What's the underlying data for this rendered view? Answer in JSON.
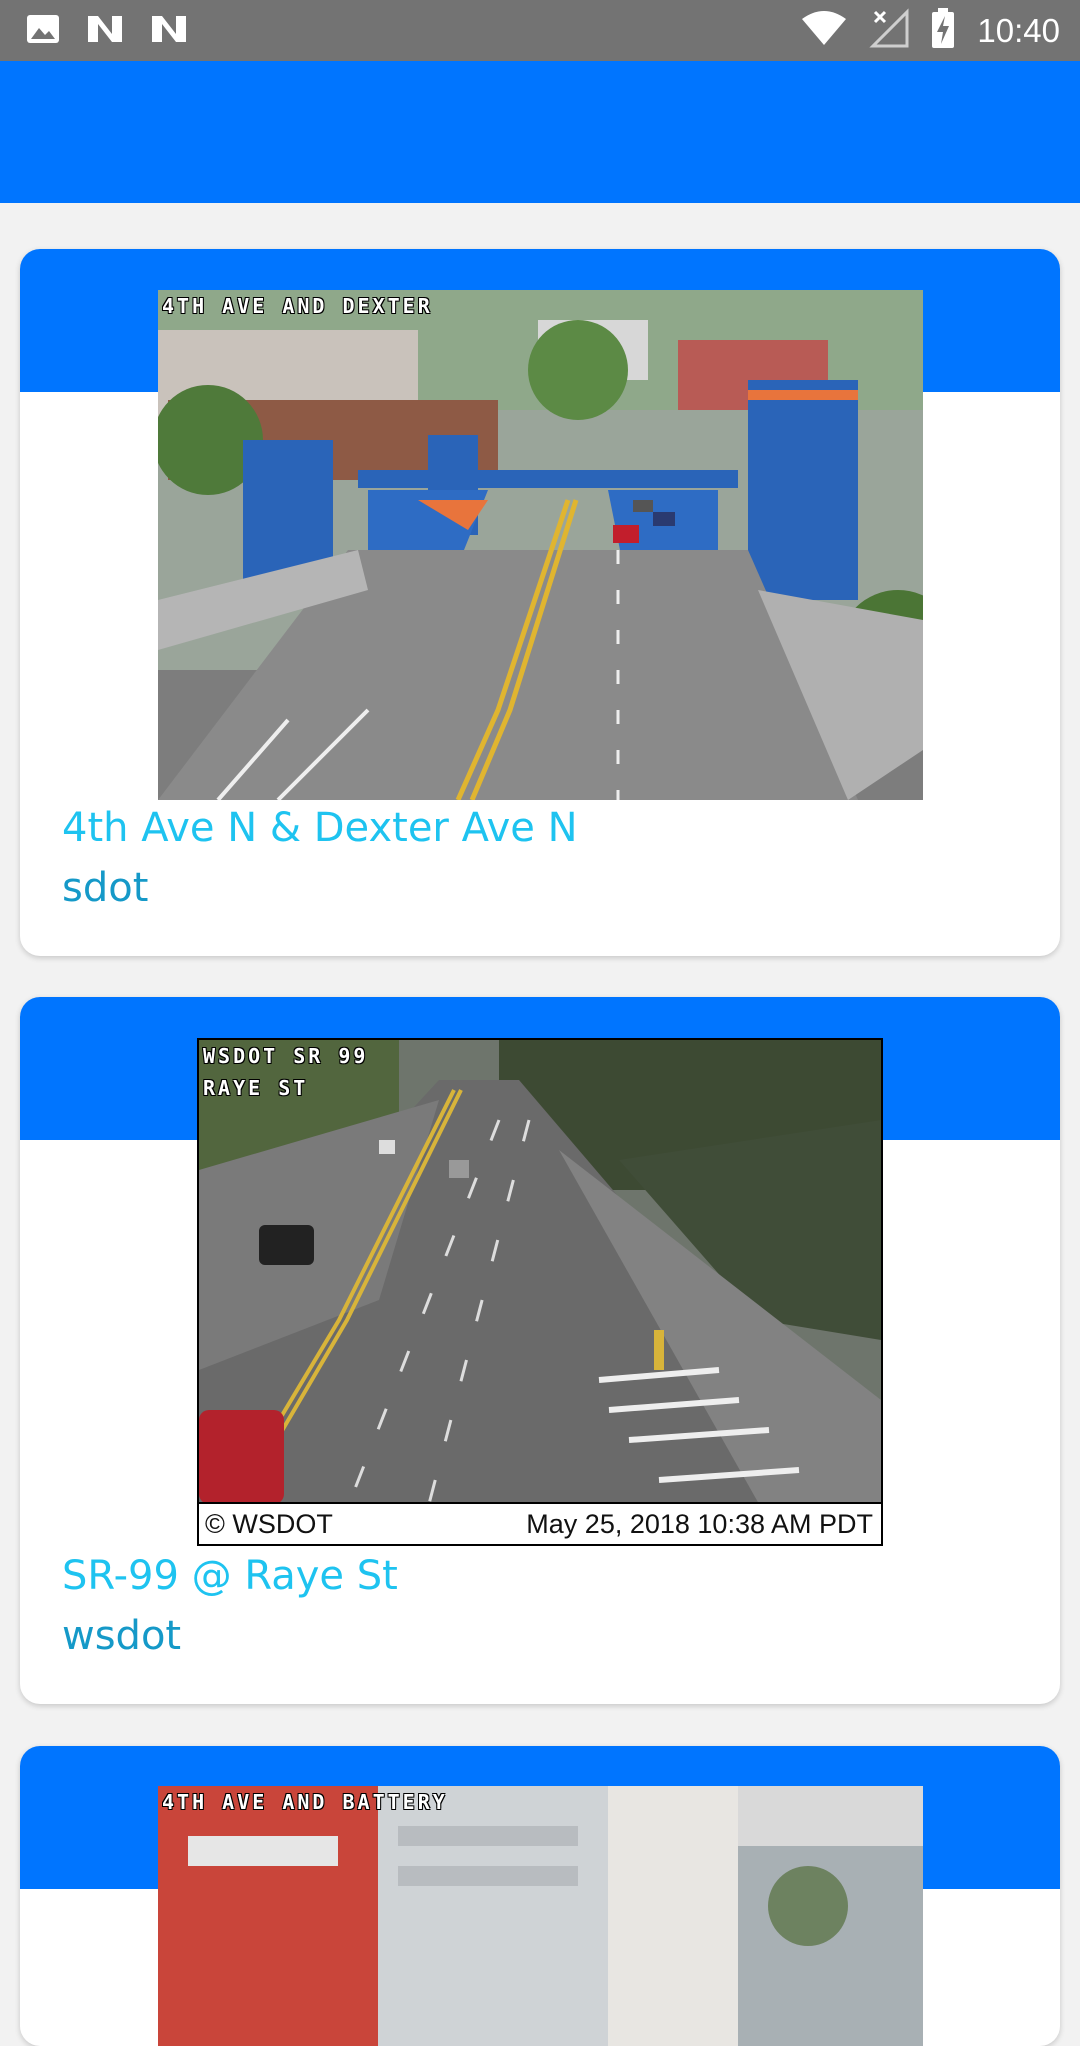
{
  "status_bar": {
    "time": "10:40",
    "left_icons": [
      "image-icon",
      "n-notification-icon",
      "n-notification-icon"
    ],
    "right_icons": [
      "wifi-icon",
      "no-signal-icon",
      "battery-charging-icon"
    ]
  },
  "colors": {
    "app_bar": "#0075ff",
    "title": "#1ec3f0",
    "source": "#1599c8",
    "status_bar": "#737373"
  },
  "cameras": [
    {
      "overlay": "4TH AVE AND DEXTER",
      "title": "4th Ave N & Dexter Ave N",
      "source": "sdot"
    },
    {
      "overlay": "WSDOT SR 99\nRAYE ST",
      "footer_left": "© WSDOT",
      "footer_right": "May 25, 2018  10:38 AM PDT",
      "title": "SR-99 @ Raye St",
      "source": "wsdot"
    },
    {
      "overlay": "4TH AVE AND BATTERY"
    }
  ]
}
